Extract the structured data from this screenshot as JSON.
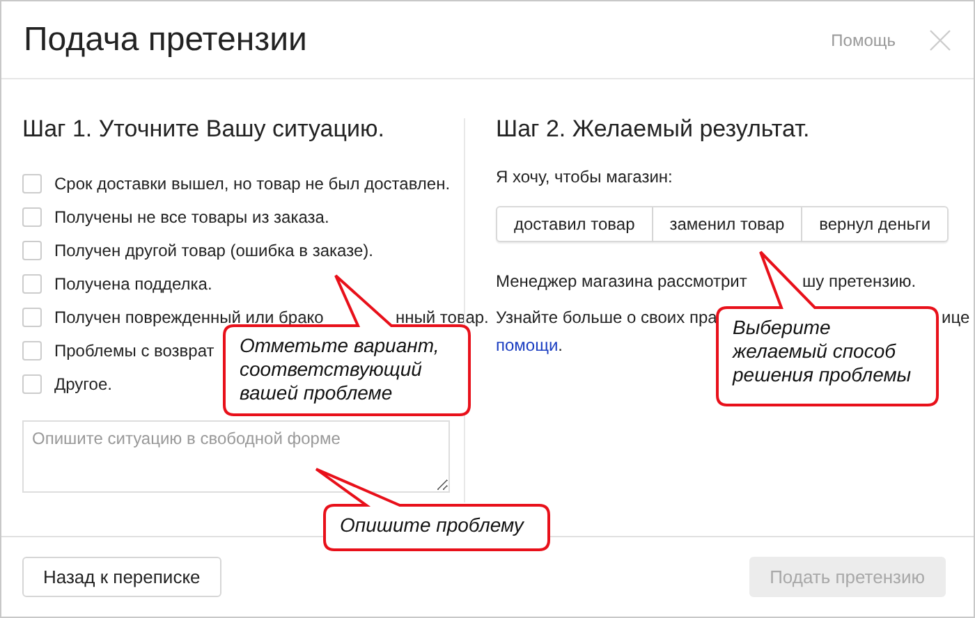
{
  "dialog": {
    "title": "Подача претензии",
    "help_link": "Помощь"
  },
  "step1": {
    "heading": "Шаг 1. Уточните Вашу ситуацию.",
    "options": [
      {
        "label": "Срок доставки вышел, но товар не был доставлен.",
        "checked": false
      },
      {
        "label": "Получены не все товары из заказа.",
        "checked": false
      },
      {
        "label": "Получен другой товар (ошибка в заказе).",
        "checked": false
      },
      {
        "label": "Получена подделка.",
        "checked": false
      },
      {
        "label": "Получен поврежденный или брако",
        "label_after": "нный товар.",
        "checked": false
      },
      {
        "label": "Проблемы с возврат",
        "checked": false
      },
      {
        "label": "Другое.",
        "checked": false
      }
    ],
    "description": {
      "placeholder": "Опишите ситуацию в свободной форме"
    }
  },
  "step2": {
    "heading": "Шаг 2. Желаемый результат.",
    "prompt": "Я хочу, чтобы магазин:",
    "choices": [
      {
        "label": "доставил товар",
        "selected": false
      },
      {
        "label": "заменил товар",
        "selected": false
      },
      {
        "label": "вернул деньги",
        "selected": false
      }
    ],
    "note": {
      "before": "Менеджер магазина рассмотрит",
      "after": "шу претензию."
    },
    "info": {
      "before": "Узнайте больше о своих пра",
      "after": "ице",
      "link": "помощи",
      "tail": "."
    }
  },
  "footer": {
    "back_button": "Назад к переписке",
    "submit_button": {
      "label": "Подать претензию",
      "disabled": true
    }
  },
  "callouts": [
    {
      "text": "Отметьте вариант, соответствующий вашей проблеме"
    },
    {
      "text": "Выберите желаемый способ решения проблемы"
    },
    {
      "text": "Опишите проблему"
    }
  ]
}
